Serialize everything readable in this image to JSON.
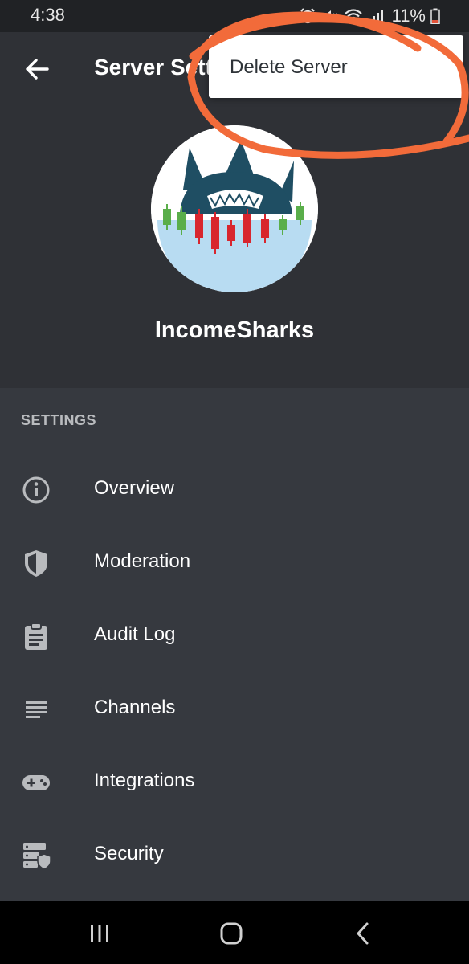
{
  "status": {
    "time": "4:38",
    "battery": "11%"
  },
  "header": {
    "title": "Server Settings",
    "server_name": "IncomeSharks"
  },
  "menu": {
    "delete_label": "Delete Server"
  },
  "settings": {
    "section_title": "SETTINGS",
    "items": [
      {
        "label": "Overview",
        "icon": "info-icon"
      },
      {
        "label": "Moderation",
        "icon": "shield-icon"
      },
      {
        "label": "Audit Log",
        "icon": "clipboard-icon"
      },
      {
        "label": "Channels",
        "icon": "channels-list-icon"
      },
      {
        "label": "Integrations",
        "icon": "gamepad-icon"
      },
      {
        "label": "Security",
        "icon": "server-shield-icon"
      }
    ]
  },
  "colors": {
    "background": "#36393f",
    "header_bg": "#2f3136",
    "annotation": "#f26b3a",
    "candle_red": "#d8262e",
    "candle_green": "#5aae4a",
    "shark": "#1f4e63"
  }
}
